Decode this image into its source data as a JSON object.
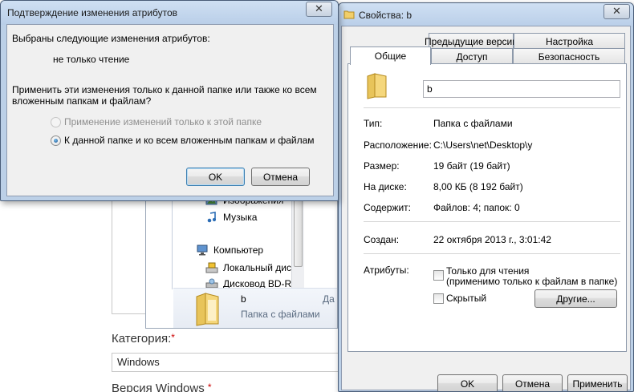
{
  "web": {
    "category_label": "Категория:",
    "category_required": "*",
    "category_value": "Windows",
    "version_label": "Версия Windows",
    "version_required": "*"
  },
  "explorer": {
    "tree": [
      {
        "label": "Изображения",
        "icon": "pictures-library-icon"
      },
      {
        "label": "Музыка",
        "icon": "music-library-icon"
      },
      {
        "label": "Компьютер",
        "icon": "computer-icon"
      },
      {
        "label": "Локальный диск",
        "icon": "local-disk-icon"
      },
      {
        "label": "Дисковод BD-RO",
        "icon": "bd-drive-icon"
      }
    ],
    "selected": {
      "name": "b",
      "type": "Папка с файлами",
      "extra": "Да"
    }
  },
  "confirm_dialog": {
    "title": "Подтверждение изменения атрибутов",
    "intro": "Выбраны следующие изменения атрибутов:",
    "change": "не только чтение",
    "question_line1": "Применить эти изменения только к данной папке или также ко всем",
    "question_line2": "вложенным папкам и файлам?",
    "option_folder_only": "Применение изменений только к этой папке",
    "option_folder_and_children": "К данной папке и ко всем вложенным папкам и файлам",
    "selected_option": "option_folder_and_children",
    "ok_label": "OK",
    "cancel_label": "Отмена",
    "close_label": "✕"
  },
  "properties_dialog": {
    "title": "Свойства: b",
    "close_label": "✕",
    "tabs_row1": [
      "Предыдущие версии",
      "Настройка"
    ],
    "tabs_row2": [
      "Общие",
      "Доступ",
      "Безопасность"
    ],
    "active_tab": "Общие",
    "name_value": "b",
    "fields": [
      {
        "label": "Тип:",
        "value": "Папка с файлами"
      },
      {
        "label": "Расположение:",
        "value": "C:\\Users\\net\\Desktop\\y"
      },
      {
        "label": "Размер:",
        "value": "19 байт (19 байт)"
      },
      {
        "label": "На диске:",
        "value": "8,00 КБ (8 192 байт)"
      },
      {
        "label": "Содержит:",
        "value": "Файлов: 4; папок: 0"
      }
    ],
    "created_label": "Создан:",
    "created_value": "22 октября 2013 г., 3:01:42",
    "attributes_label": "Атрибуты:",
    "readonly_line1": "Только для чтения",
    "readonly_line2": "(применимо только к файлам в папке)",
    "readonly_checked": false,
    "hidden_label": "Скрытый",
    "hidden_checked": false,
    "other_button": "Другие...",
    "ok_label": "OK",
    "cancel_label": "Отмена",
    "apply_label": "Применить"
  },
  "colors": {
    "title_bar": "#c4d6ec",
    "dialog_face": "#f0f0f0",
    "default_button_border": "#3c7fb1"
  }
}
